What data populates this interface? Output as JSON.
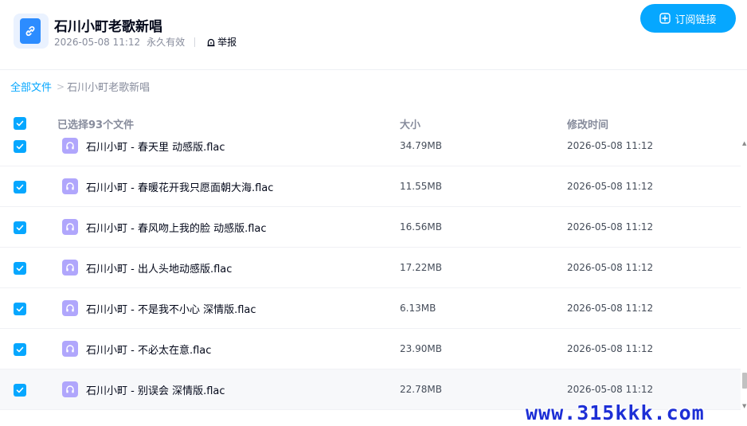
{
  "share": {
    "title": "石川小町老歌新唱",
    "date": "2026-05-08 11:12",
    "validity": "永久有效",
    "report_label": "举报",
    "subscribe_label": "订阅链接"
  },
  "breadcrumb": {
    "root": "全部文件",
    "separator": ">",
    "current": "石川小町老歌新唱"
  },
  "list_header": {
    "selected_text": "已选择93个文件",
    "size_col": "大小",
    "time_col": "修改时间"
  },
  "files": [
    {
      "name": "石川小町 - 春天里 动感版.flac",
      "size": "34.79MB",
      "modified": "2026-05-08 11:12"
    },
    {
      "name": "石川小町 - 春暖花开我只愿面朝大海.flac",
      "size": "11.55MB",
      "modified": "2026-05-08 11:12"
    },
    {
      "name": "石川小町 - 春风吻上我的脸 动感版.flac",
      "size": "16.56MB",
      "modified": "2026-05-08 11:12"
    },
    {
      "name": "石川小町 - 出人头地动感版.flac",
      "size": "17.22MB",
      "modified": "2026-05-08 11:12"
    },
    {
      "name": "石川小町 - 不是我不小心 深情版.flac",
      "size": "6.13MB",
      "modified": "2026-05-08 11:12"
    },
    {
      "name": "石川小町 - 不必太在意.flac",
      "size": "23.90MB",
      "modified": "2026-05-08 11:12"
    },
    {
      "name": "石川小町 - 别误会 深情版.flac",
      "size": "22.78MB",
      "modified": "2026-05-08 11:12"
    }
  ],
  "icons": {
    "share_logo": "link-icon",
    "report": "alarm-icon",
    "subscribe": "plus-square-icon",
    "file": "headphones-icon",
    "checkbox": "checkmark-icon"
  },
  "colors": {
    "accent": "#06a7ff",
    "audio_icon": "#b0a6fc",
    "link_logo": "#2c8cff",
    "watermark": "#1d2fd6"
  },
  "watermark": "www.315kkk.com"
}
